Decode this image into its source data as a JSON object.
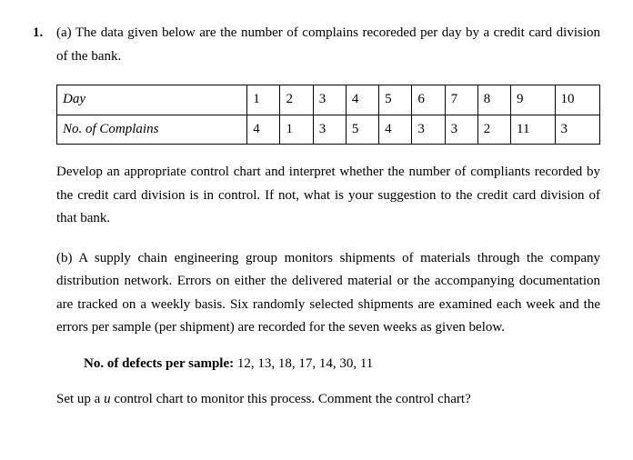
{
  "question_number": "1.",
  "part_a": {
    "intro": "(a) The data given below are the number of complains recoreded per day by a credit card division of  the bank.",
    "table": {
      "row1_label": "Day",
      "row2_label": "No. of Complains",
      "days": [
        "1",
        "2",
        "3",
        "4",
        "5",
        "6",
        "7",
        "8",
        "9",
        "10"
      ],
      "complains": [
        "4",
        "1",
        "3",
        "5",
        "4",
        "3",
        "3",
        "2",
        "11",
        "3"
      ]
    },
    "task": "Develop an appropriate control chart and interpret whether the number of compliants recorded by the credit card division is in control. If not, what is your suggestion to the credit card division of that bank."
  },
  "part_b": {
    "intro": "(b) A supply chain engineering group monitors shipments of materials through the company distribution network. Errors on either the delivered material or the accompanying documentation are tracked on a weekly basis. Six randomly selected shipments are examined each week and the errors per sample (per shipment) are recorded for the seven weeks as given below.",
    "defects_label": "No. of defects per sample:",
    "defects_values": "  12, 13, 18, 17, 14, 30, 11",
    "task_prefix": "Set up a ",
    "task_var": "u",
    "task_suffix": " control chart to monitor this process. Comment the control chart?"
  }
}
